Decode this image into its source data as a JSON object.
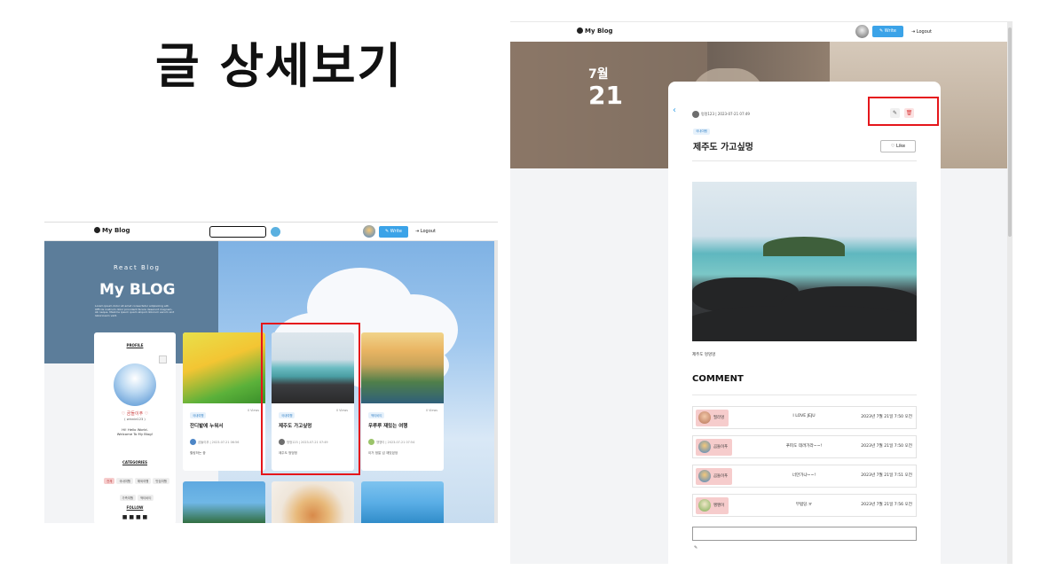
{
  "page_title": "글 상세보기",
  "list_screen": {
    "nav": {
      "brand": "My Blog",
      "write_label": "Write",
      "logout_label": "Logout"
    },
    "hero": {
      "subtitle": "React Blog",
      "title": "My BLOG",
      "lorem": "Lorem ipsum dolor sit amet consectetur adipisicing elit. Officiis nostrum dolor provident facere deserunt magnam. Ab neque. Maxime ipsum quam aliquid dolorum earum sint laboriosam velit."
    },
    "profile": {
      "heading": "PROFILE",
      "name": "♡ 곰돌이푸 ♡",
      "handle": "( winnie123 )",
      "intro_line1": "Hi! Hello World.",
      "intro_line2": "Welcome To My Blog!",
      "categories_heading": "CATEGORIES",
      "categories": [
        "전체",
        "국내여행",
        "해외여행",
        "맛집여행",
        "가족여행",
        "액티비티"
      ],
      "follow_heading": "FOLLOW"
    },
    "posts": [
      {
        "tag": "국내여행",
        "views": "0 Views",
        "title": "잔디밭에 누워서",
        "author": "곰돌이푸",
        "date": "2023-07-21 06:56",
        "body": "힐링하는 중"
      },
      {
        "tag": "국내여행",
        "views": "0 Views",
        "title": "제주도 가고싶멍",
        "author": "멍멍123",
        "date": "2023-07-21 07:49",
        "body": "제주도 멍멍멍"
      },
      {
        "tag": "액티비티",
        "views": "0 Views",
        "title": "우루루 재밌는 여행",
        "author": "땡땡이",
        "date": "2023-07-21 07:54",
        "body": "이거 정말 넘 재밌었엉"
      }
    ]
  },
  "detail_screen": {
    "nav": {
      "brand": "My Blog",
      "write_label": "Write",
      "logout_label": "Logout"
    },
    "date_month": "7월",
    "date_day": "21",
    "author": "멍멍123",
    "timestamp": "2023-07-21 07:49",
    "category": "국내여행",
    "post_title": "제주도 가고싶멍",
    "like_label": "Like",
    "caption": "제주도 멍멍멍",
    "comment_heading": "COMMENT",
    "comments": [
      {
        "user": "필라멍",
        "text": "I LOVE JEJU",
        "date": "2023년 7월 21일 7:50 오전",
        "color": "#c98a6b"
      },
      {
        "user": "곰돌이푸",
        "text": "푸피도 데려가라~~!",
        "date": "2023년 7월 21일 7:50 오전",
        "color": "#4d86c6"
      },
      {
        "user": "곰돌이푸",
        "text": "너만가냐~~!",
        "date": "2023년 7월 21일 7:51 오전",
        "color": "#4d86c6"
      },
      {
        "user": "땡땡이",
        "text": "부럽당.ㅠ",
        "date": "2023년 7월 21일 7:56 오전",
        "color": "#9bc46a"
      }
    ]
  }
}
